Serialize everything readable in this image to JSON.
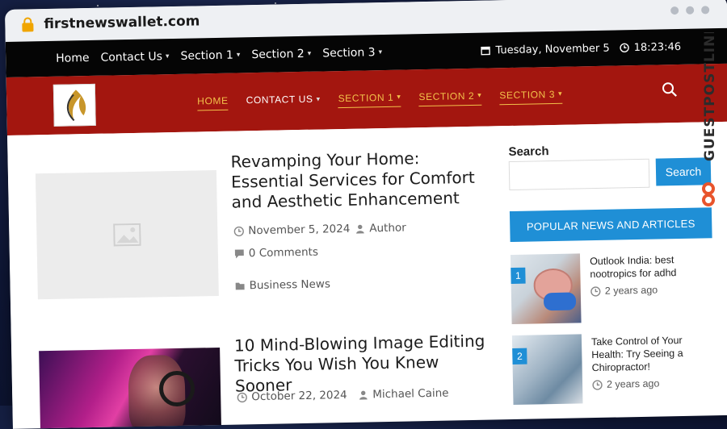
{
  "browser": {
    "url": "firstnewswallet.com"
  },
  "topbar": {
    "nav": [
      {
        "label": "Home",
        "has_caret": false
      },
      {
        "label": "Contact Us",
        "has_caret": true
      },
      {
        "label": "Section 1",
        "has_caret": true
      },
      {
        "label": "Section 2",
        "has_caret": true
      },
      {
        "label": "Section 3",
        "has_caret": true
      }
    ],
    "date": "Tuesday, November 5",
    "time": "18:23:46"
  },
  "mainnav": {
    "items": [
      {
        "label": "HOME",
        "style": "gold"
      },
      {
        "label": "CONTACT US",
        "style": "white"
      },
      {
        "label": "SECTION 1",
        "style": "gold"
      },
      {
        "label": "SECTION 2",
        "style": "gold"
      },
      {
        "label": "SECTION 3",
        "style": "gold"
      }
    ]
  },
  "posts": [
    {
      "title": "Revamping Your Home: Essential Services for Comfort and Aesthetic Enhancement",
      "date": "November 5, 2024",
      "author": "Author",
      "comments": "0 Comments",
      "category": "Business News"
    },
    {
      "title": "10 Mind-Blowing Image Editing Tricks You Wish You Knew Sooner",
      "date": "October 22, 2024",
      "author": "Michael Caine"
    }
  ],
  "sidebar": {
    "search_label": "Search",
    "search_button": "Search",
    "popular_heading": "POPULAR NEWS AND ARTICLES",
    "popular": [
      {
        "rank": "1",
        "title": "Outlook India: best nootropics for adhd",
        "time": "2 years ago"
      },
      {
        "rank": "2",
        "title": "Take Control of Your Health: Try Seeing a Chiropractor!",
        "time": "2 years ago"
      }
    ]
  },
  "watermark": {
    "text": "GUESTPOSTLINKS"
  },
  "colors": {
    "accent": "#1f8fd6",
    "nav_red": "#a3160f",
    "nav_gold": "#f2c14a",
    "watermark": "#e8542c"
  }
}
